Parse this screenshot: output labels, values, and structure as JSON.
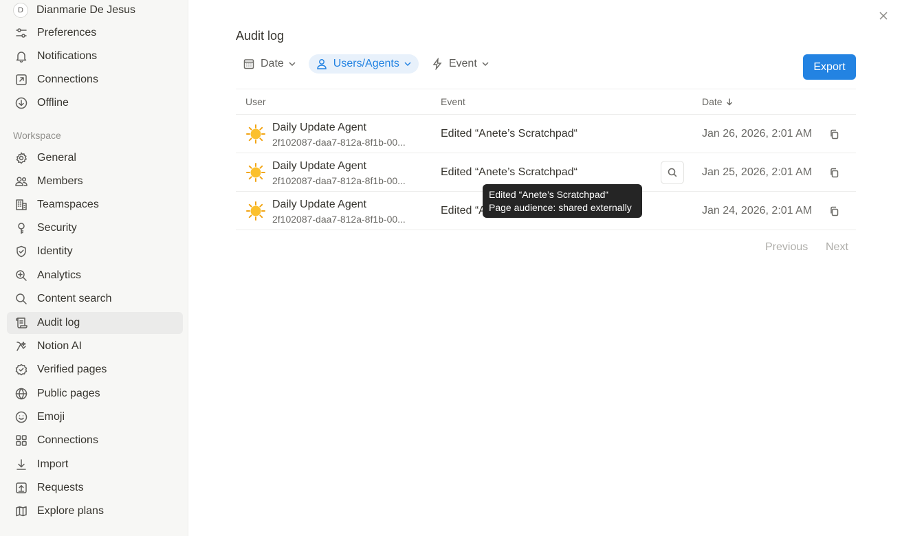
{
  "account": {
    "initial": "D",
    "name": "Dianmarie De Jesus"
  },
  "sidebar": {
    "account_items": [
      {
        "label": "Preferences",
        "icon": "sliders-icon"
      },
      {
        "label": "Notifications",
        "icon": "bell-icon"
      },
      {
        "label": "Connections",
        "icon": "arrow-up-right-box-icon"
      },
      {
        "label": "Offline",
        "icon": "download-circle-icon"
      }
    ],
    "workspace_label": "Workspace",
    "workspace_items": [
      {
        "label": "General",
        "icon": "gear-icon"
      },
      {
        "label": "Members",
        "icon": "people-icon"
      },
      {
        "label": "Teamspaces",
        "icon": "building-icon"
      },
      {
        "label": "Security",
        "icon": "key-icon"
      },
      {
        "label": "Identity",
        "icon": "shield-check-icon"
      },
      {
        "label": "Analytics",
        "icon": "zoom-plus-icon"
      },
      {
        "label": "Content search",
        "icon": "search-icon"
      },
      {
        "label": "Audit log",
        "icon": "scroll-icon"
      },
      {
        "label": "Notion AI",
        "icon": "ai-icon"
      },
      {
        "label": "Verified pages",
        "icon": "verified-badge-icon"
      },
      {
        "label": "Public pages",
        "icon": "globe-icon"
      },
      {
        "label": "Emoji",
        "icon": "smiley-icon"
      },
      {
        "label": "Connections",
        "icon": "grid-icon"
      },
      {
        "label": "Import",
        "icon": "download-arrow-icon"
      },
      {
        "label": "Requests",
        "icon": "upload-box-icon"
      },
      {
        "label": "Explore plans",
        "icon": "map-icon"
      }
    ],
    "active": "Audit log"
  },
  "main": {
    "title": "Audit log",
    "filters": [
      {
        "label": "Date",
        "icon": "calendar-icon",
        "active": false
      },
      {
        "label": "Users/Agents",
        "icon": "person-icon",
        "active": true
      },
      {
        "label": "Event",
        "icon": "lightning-icon",
        "active": false
      }
    ],
    "export_label": "Export",
    "table": {
      "headers": {
        "user": "User",
        "event": "Event",
        "date": "Date"
      },
      "rows": [
        {
          "user_name": "Daily Update Agent",
          "user_id": "2f102087-daa7-812a-8f1b-00...",
          "event": "Edited “Anete’s Scratchpad“",
          "date": "Jan 26, 2026, 2:01 AM"
        },
        {
          "user_name": "Daily Update Agent",
          "user_id": "2f102087-daa7-812a-8f1b-00...",
          "event": "Edited “Anete’s Scratchpad“",
          "date": "Jan 25, 2026, 2:01 AM"
        },
        {
          "user_name": "Daily Update Agent",
          "user_id": "2f102087-daa7-812a-8f1b-00...",
          "event": "Edited “A",
          "date": "Jan 24, 2026, 2:01 AM"
        }
      ]
    },
    "tooltip": {
      "line1": "Edited “Anete’s Scratchpad“",
      "line2": "Page audience: shared externally"
    },
    "pagination": {
      "previous": "Previous",
      "next": "Next"
    }
  },
  "colors": {
    "accent": "#2383e2",
    "sidebar_bg": "#f7f7f5",
    "tooltip_bg": "#252525"
  }
}
